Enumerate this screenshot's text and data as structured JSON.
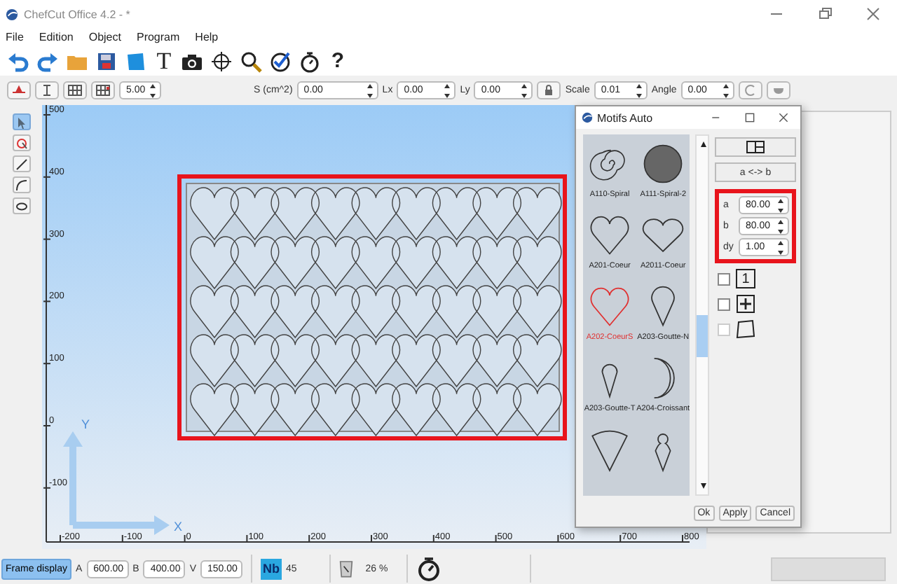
{
  "window": {
    "title": "ChefCut Office 4.2 - *"
  },
  "menu": [
    "File",
    "Edition",
    "Object",
    "Program",
    "Help"
  ],
  "toolbar": {
    "text_glyph": "T",
    "help_glyph": "?"
  },
  "properties": {
    "step": "5.00",
    "fields": [
      {
        "label": "S (cm^2)",
        "value": "0.00"
      },
      {
        "label": "Lx",
        "value": "0.00"
      },
      {
        "label": "Ly",
        "value": "0.00"
      }
    ],
    "scale": {
      "label": "Scale",
      "value": "0.01"
    },
    "angle": {
      "label": "Angle",
      "value": "0.00"
    }
  },
  "tools": [
    {
      "selected": true
    },
    {
      "selected": false
    },
    {
      "selected": false
    },
    {
      "selected": false
    },
    {
      "selected": false
    }
  ],
  "canvas": {
    "y_ticks": [
      "500",
      "400",
      "300",
      "200",
      "100",
      "0",
      "-100"
    ],
    "x_ticks": [
      "-200",
      "-100",
      "0",
      "100",
      "200",
      "300",
      "400",
      "500",
      "600",
      "700",
      "800"
    ],
    "axis_y": "Y",
    "axis_x": "X"
  },
  "dialog": {
    "title": "Motifs Auto",
    "patterns": [
      {
        "kind": "spiral",
        "label": "A110-Spiral",
        "selected": false
      },
      {
        "kind": "spiral-disc",
        "label": "A111-Spiral-2",
        "selected": false
      },
      {
        "kind": "heart",
        "label": "A201-Coeur",
        "selected": false
      },
      {
        "kind": "heart-wide",
        "label": "A2011-Coeur",
        "selected": false
      },
      {
        "kind": "heart",
        "label": "A202-CoeurS",
        "selected": true
      },
      {
        "kind": "drop-wide",
        "label": "A203-Goutte-N",
        "selected": false
      },
      {
        "kind": "drop",
        "label": "A203-Goutte-T",
        "selected": false
      },
      {
        "kind": "crescent",
        "label": "A204-Croissant",
        "selected": false
      },
      {
        "kind": "sector",
        "selected": false
      },
      {
        "kind": "pawn",
        "selected": false
      }
    ],
    "swap_button": "a <-> b",
    "params": [
      {
        "label": "a",
        "value": "80.00"
      },
      {
        "label": "b",
        "value": "80.00"
      },
      {
        "label": "dy",
        "value": "1.00"
      }
    ],
    "options": [
      {
        "kind": "number",
        "glyph": "1",
        "checked": false,
        "disabled": false
      },
      {
        "kind": "plus",
        "checked": false,
        "disabled": false
      },
      {
        "kind": "square",
        "checked": false,
        "disabled": true
      }
    ],
    "buttons": [
      "Ok",
      "Apply",
      "Cancel"
    ]
  },
  "status_bar": {
    "frame_display": {
      "label": "Frame display",
      "selected": true
    },
    "fields": [
      {
        "label": "A",
        "value": "600.00"
      },
      {
        "label": "B",
        "value": "400.00"
      },
      {
        "label": "V",
        "value": "150.00"
      }
    ],
    "count_badge": "Nb",
    "count": "45",
    "percent": "26 %"
  }
}
